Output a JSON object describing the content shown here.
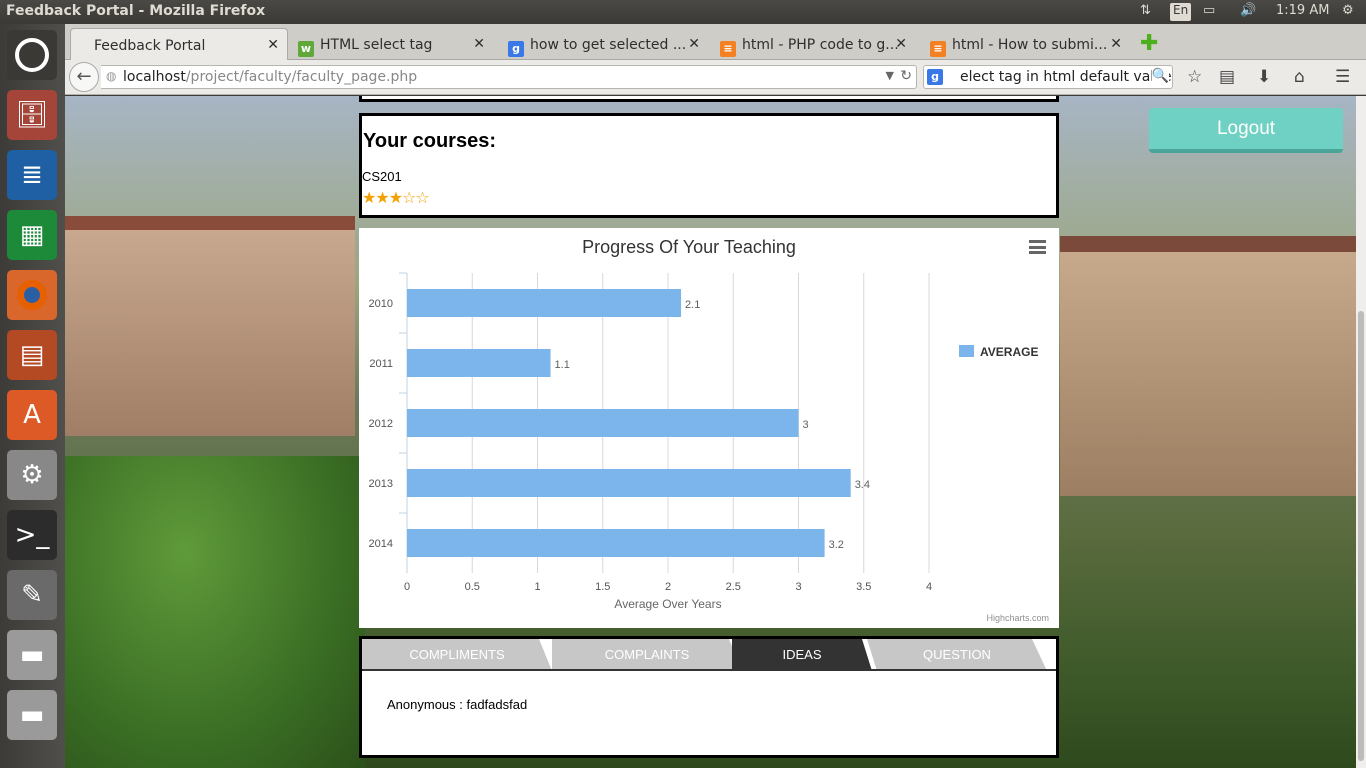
{
  "os": {
    "window_title": "Feedback Portal - Mozilla Firefox",
    "keyboard": "En",
    "clock": "1:19 AM"
  },
  "browser": {
    "tabs": [
      {
        "label": "Feedback Portal",
        "active": true
      },
      {
        "label": "HTML select tag"
      },
      {
        "label": "how to get selected ..."
      },
      {
        "label": "html - PHP code to g..."
      },
      {
        "label": "html - How to submi..."
      }
    ],
    "url_host": "localhost",
    "url_path": "/project/faculty/faculty_page.php",
    "search_text": "elect tag in html default value"
  },
  "page": {
    "logout_label": "Logout",
    "courses_heading": "Your courses:",
    "course": "CS201",
    "rating_stars": "★★★☆☆",
    "feedback_tabs": [
      "COMPLIMENTS",
      "COMPLAINTS",
      "IDEAS",
      "QUESTION"
    ],
    "active_feedback_tab": "IDEAS",
    "feedback_entry": "Anonymous : fadfadsfad"
  },
  "chart_data": {
    "type": "bar",
    "orientation": "horizontal",
    "title": "Progress Of Your Teaching",
    "categories": [
      "2010",
      "2011",
      "2012",
      "2013",
      "2014"
    ],
    "series": [
      {
        "name": "AVERAGE",
        "values": [
          2.1,
          1.1,
          3,
          3.4,
          3.2
        ],
        "color": "#7cb5ec"
      }
    ],
    "xlabel": "Average Over Years",
    "xlim": [
      0,
      4
    ],
    "ticks": [
      "0",
      "0.5",
      "1",
      "1.5",
      "2",
      "2.5",
      "3",
      "3.5",
      "4"
    ],
    "credits": "Highcharts.com",
    "legend_position": "right"
  }
}
